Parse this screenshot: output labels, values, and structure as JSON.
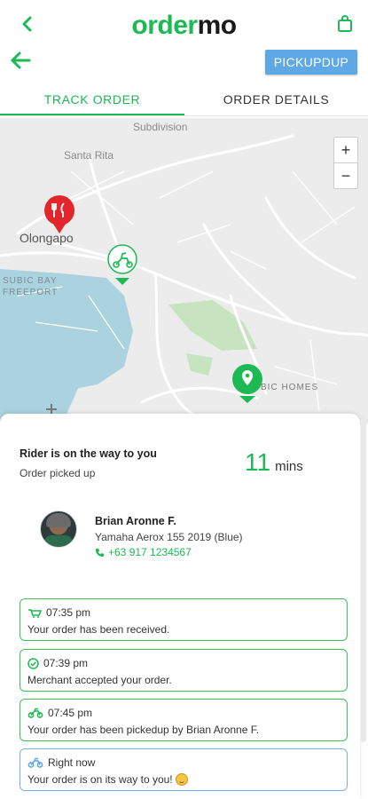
{
  "brand": {
    "part1": "order",
    "part2": "mo",
    "green": "#1db954",
    "dark": "#1a1a1a"
  },
  "header": {
    "pickup_label": "PICKUPDUP"
  },
  "tabs": [
    {
      "label": "TRACK ORDER",
      "active": true
    },
    {
      "label": "ORDER DETAILS",
      "active": false
    }
  ],
  "map": {
    "labels": {
      "subdivision": "Subdivision",
      "santa_rita": "Santa Rita",
      "olongapo": "Olongapo",
      "subic_bay": "SUBIC BAY",
      "freeport": "FREEPORT",
      "homes": "BIC HOMES"
    },
    "zoom_in": "+",
    "zoom_out": "−",
    "icons": [
      "restaurant-marker",
      "rider-marker",
      "destination-marker"
    ]
  },
  "status": {
    "title": "Rider is on the way to you",
    "subtitle": "Order picked up",
    "eta_value": "11",
    "eta_unit": "mins"
  },
  "rider": {
    "name": "Brian Aronne F.",
    "vehicle": "Yamaha Aerox 155 2019 (Blue)",
    "phone": "+63 917 1234567"
  },
  "timeline": [
    {
      "time": "07:35 pm",
      "message": "Your order has been received.",
      "icon": "cart-icon"
    },
    {
      "time": "07:39 pm",
      "message": "Merchant accepted your order.",
      "icon": "check-circle-icon"
    },
    {
      "time": "07:45 pm",
      "message": "Your order has been pickedup by Brian Aronne F.",
      "icon": "motorcycle-icon"
    },
    {
      "time": "Right now",
      "message": "Your order is on its way to you!",
      "icon": "motorcycle-icon"
    }
  ],
  "colors": {
    "accent": "#1db954",
    "pickup_button": "#5fa8e6",
    "current_card_border": "#7aaee6"
  }
}
